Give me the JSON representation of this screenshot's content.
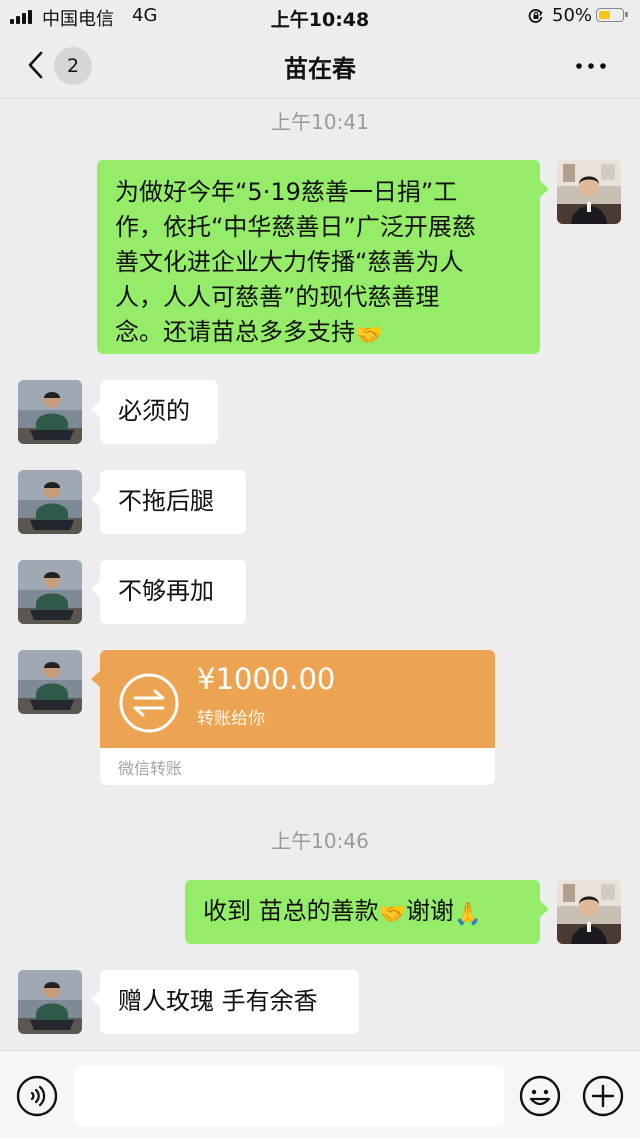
{
  "status_bar": {
    "carrier": "中国电信",
    "network": "4G",
    "time": "上午10:48",
    "battery_percent": "50%",
    "battery_level": 0.5,
    "battery_color": "#F5C517"
  },
  "nav": {
    "unread_count": "2",
    "title": "苗在春",
    "back_icon": "chevron-left-icon",
    "more_icon": "ellipsis-icon"
  },
  "colors": {
    "background": "#EDEDED",
    "outgoing_bubble": "#95EC69",
    "incoming_bubble": "#FFFFFF",
    "transfer_card": "#EDA452"
  },
  "timestamps": [
    "上午10:41",
    "上午10:46"
  ],
  "messages": [
    {
      "direction": "outgoing",
      "lines": [
        "为做好今年“5·19慈善一日捐”工",
        "作，依托“中华慈善日”广泛开展慈",
        "善文化进企业大力传播“慈善为人",
        "人，人人可慈善”的现代慈善理"
      ],
      "last_line": "念。还请苗总多多支持",
      "emoji": "🤝"
    },
    {
      "direction": "incoming",
      "text": "必须的"
    },
    {
      "direction": "incoming",
      "text": "不拖后腿"
    },
    {
      "direction": "incoming",
      "text": "不够再加"
    },
    {
      "direction": "outgoing",
      "text_a": "收到 苗总的善款",
      "emoji_a": "🤝",
      "text_b": "谢谢",
      "emoji_b": "🙏"
    },
    {
      "direction": "incoming",
      "text": "赠人玫瑰 手有余香"
    }
  ],
  "transfer": {
    "amount": "¥1000.00",
    "description": "转账给你",
    "label": "微信转账",
    "icon": "transfer-arrows-icon"
  },
  "input_bar": {
    "placeholder": "",
    "voice_icon": "voice-icon",
    "emoji_icon": "smiley-icon",
    "plus_icon": "plus-icon"
  }
}
